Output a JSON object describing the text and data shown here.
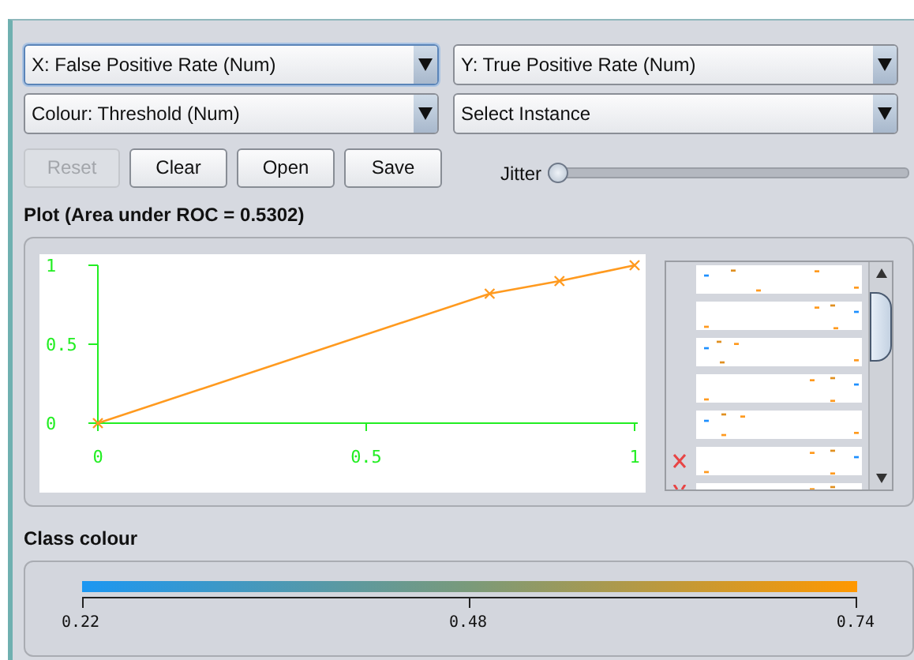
{
  "selectors": [
    {
      "label": "X: False Positive Rate (Num)",
      "focused": true
    },
    {
      "label": "Y: True Positive Rate (Num)",
      "focused": false
    },
    {
      "label": "Colour: Threshold (Num)",
      "focused": false
    },
    {
      "label": "Select Instance",
      "focused": false
    }
  ],
  "buttons": [
    {
      "label": "Reset",
      "disabled": true
    },
    {
      "label": "Clear",
      "disabled": false
    },
    {
      "label": "Open",
      "disabled": false
    },
    {
      "label": "Save",
      "disabled": false
    }
  ],
  "jitter": {
    "label": "Jitter",
    "level": 0
  },
  "plot": {
    "title": "Plot (Area under ROC = 0.5302)",
    "chart_data": {
      "type": "line",
      "x": [
        0,
        0.73,
        0.86,
        1
      ],
      "series": [
        {
          "color": "#ff9a1f",
          "marker": "x",
          "values": [
            0,
            0.82,
            0.9,
            1
          ]
        }
      ],
      "xlim": [
        0,
        1
      ],
      "ylim": [
        0,
        1
      ],
      "xticks": [
        {
          "value": 0,
          "label": "0"
        },
        {
          "value": 0.5,
          "label": "0.5"
        },
        {
          "value": 1,
          "label": "1"
        }
      ],
      "yticks": [
        {
          "value": 0,
          "label": "0"
        },
        {
          "value": 0.5,
          "label": "0.5"
        },
        {
          "value": 1,
          "label": "1"
        }
      ]
    }
  },
  "class_colour": {
    "title": "Class colour",
    "ticks": [
      "0.22",
      "0.48",
      "0.74"
    ]
  }
}
